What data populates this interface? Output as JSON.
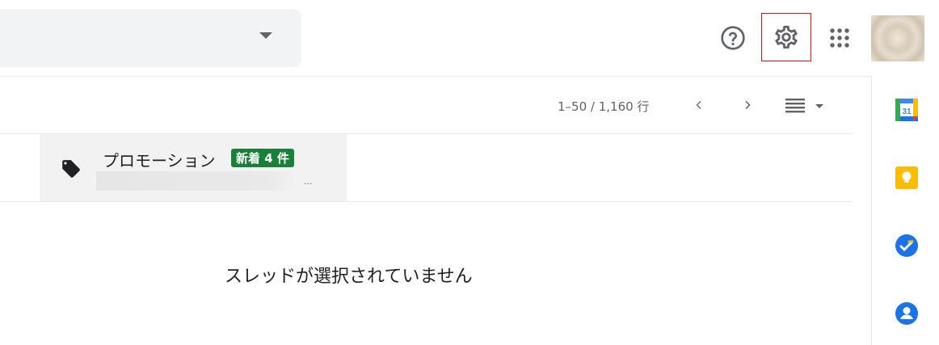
{
  "header": {
    "icons": {
      "search_dropdown": "arrow-drop-down-icon",
      "help": "help-circle-icon",
      "settings": "gear-icon",
      "apps": "apps-grid-icon"
    },
    "highlight_color": "#e01010"
  },
  "toolbar": {
    "page_range": "1–50 / 1,160 行",
    "icons": {
      "prev": "chevron-left-icon",
      "next": "chevron-right-icon",
      "density": "density-lines-icon"
    }
  },
  "inbox": {
    "promotions": {
      "title": "プロモーション",
      "badge": "新着 4 件",
      "badge_color": "#188038",
      "ellipsis": "...",
      "icon": "tag-icon"
    }
  },
  "reading_pane": {
    "empty_message": "スレッドが選択されていません"
  },
  "side_panel": {
    "apps": [
      "calendar-icon",
      "keep-icon",
      "tasks-icon",
      "contacts-icon"
    ],
    "calendar_day": "31"
  }
}
